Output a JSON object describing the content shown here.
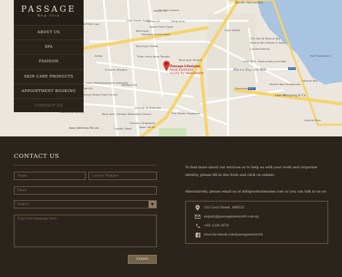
{
  "brand": {
    "title": "PASSAGE",
    "subtitle": "New York"
  },
  "menu": [
    "ABOUT US",
    "SPA",
    "FASHION",
    "SKIN CARE PRODUCTS",
    "APPOINTMENT BOOKING",
    "CONTACT US"
  ],
  "map": {
    "pin_title": "Passage Lifestyles",
    "pin_lines": [
      "facial treatment",
      "strictly by appointment"
    ],
    "labels": [
      "Zenith Harmonics",
      "Far East Square",
      "Club Street Social",
      "Telok Ayer",
      "Beaufort Suites Hotel",
      "Telok Ayer Street",
      "Amoy",
      "Thian Hock Keng Temple",
      "Telok Ayer Market",
      "Al Abrar Mosque",
      "Urban Redevelopment Authority",
      "Yan Kit",
      "Amoy Street Food Centre",
      "Sanchezdy Beauty",
      "Telok Ayer Chinese Methodist Church",
      "Grande @ Robinson",
      "The Straits Singapore",
      "Outrolcu Singapore",
      "Capital Tower",
      "Body Wellness Pte Ltd",
      "Marina Bay Link Mall",
      "Downtown",
      "Lew Wenyong & Co",
      "Central Blvd",
      "UOB ATM - Marina Bay Link Mall",
      "The Sail @ Marina Bay",
      "Marina Bay Rental & Sales",
      "Conrad Marina",
      "Marina Bay Residences",
      "Marina Bay",
      "Cecil Street",
      "The Promontory",
      "Ming Arch",
      "Maxwell Rd",
      "Boon Tat St",
      "Church St",
      "Wallich St",
      "AFONG Spa",
      "Sgrow Paint Store"
    ],
    "route_badges": [
      "DT17",
      "DT16"
    ]
  },
  "contact": {
    "title": "CONTACT US",
    "placeholders": {
      "name": "Name",
      "phone": "Contact Number",
      "email": "Email",
      "subject": "Subject",
      "message": "Type your message here"
    },
    "submit": "Submit",
    "intro": "To find more about our services or to help us with your work and corporate identity, please fill in this form and click on submit.",
    "alt": "Alternatively, please email us at info@websitename.com or you can talk to us on",
    "address": "133 Cecil Street, 069535",
    "email": "enquiry@passagenewyork.com.sg",
    "phone": "+65 1234 5678",
    "facebook": "www.facebook.com/passagenewyork"
  },
  "colors": {
    "bg": "#2b241c",
    "accent": "#74634a",
    "pin": "#d9342b"
  }
}
